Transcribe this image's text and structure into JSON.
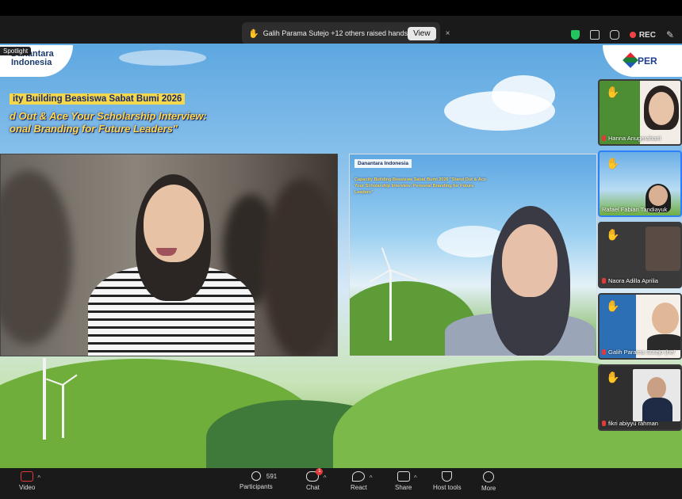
{
  "notification": {
    "icon": "raised-hand-icon",
    "message": "Galih Parama Sutejo +12 others raised hands",
    "view_label": "View",
    "close_label": "×"
  },
  "topbar": {
    "rec_label": "REC"
  },
  "spotlight_label": "Spotlight",
  "slide": {
    "org_left": "Danantara Indonesia",
    "org_right": "PER",
    "line1": "ity Building Beasiswa Sabat Bumi 2026",
    "line2": "d Out & Ace Your Scholarship Interview:",
    "line3": "onal Branding for Future Leaders\""
  },
  "guest_tile": {
    "logo_text": "Danantara Indonesia",
    "title_text": "Capacity Building Beasiswa Sabat Bumi 2026 \"Stand Out & Ace Your Scholarship Interview: Personal Branding for Future Leaders\""
  },
  "participants": [
    {
      "name": "Hanna Anugerahani",
      "hand": true,
      "mic_muted": true
    },
    {
      "name": "Rafael Fabian Tandiayuk",
      "hand": true,
      "mic_muted": false
    },
    {
      "name": "Naora Adilla Aprilia",
      "hand": true,
      "mic_muted": true
    },
    {
      "name": "Galih Parama Sutejo (he/",
      "hand": true,
      "mic_muted": true
    },
    {
      "name": "fikri abiyyu rahman",
      "hand": true,
      "mic_muted": true
    }
  ],
  "toolbar": {
    "video": "Video",
    "participants": "Participants",
    "participants_count": "591",
    "chat": "Chat",
    "chat_badge": "1",
    "react": "React",
    "share": "Share",
    "host_tools": "Host tools",
    "more": "More"
  },
  "colors": {
    "accent_blue": "#2d7ff9",
    "rec_red": "#ef4444",
    "shield_green": "#22c55e"
  }
}
